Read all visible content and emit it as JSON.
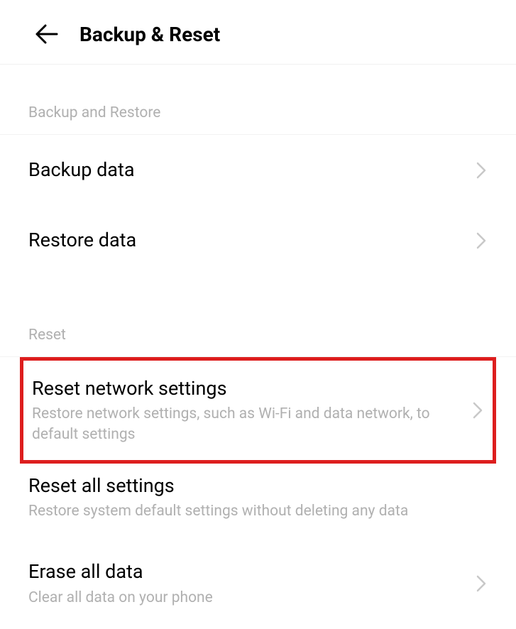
{
  "header": {
    "title": "Backup & Reset"
  },
  "sections": {
    "backup": {
      "header": "Backup and Restore",
      "backup_data": {
        "title": "Backup data"
      },
      "restore_data": {
        "title": "Restore data"
      }
    },
    "reset": {
      "header": "Reset",
      "reset_network": {
        "title": "Reset network settings",
        "subtitle": "Restore network settings, such as Wi-Fi and data network, to default settings"
      },
      "reset_all": {
        "title": "Reset all settings",
        "subtitle": "Restore system default settings without deleting any data"
      },
      "erase_all": {
        "title": "Erase all data",
        "subtitle": "Clear all data on your phone"
      }
    }
  }
}
